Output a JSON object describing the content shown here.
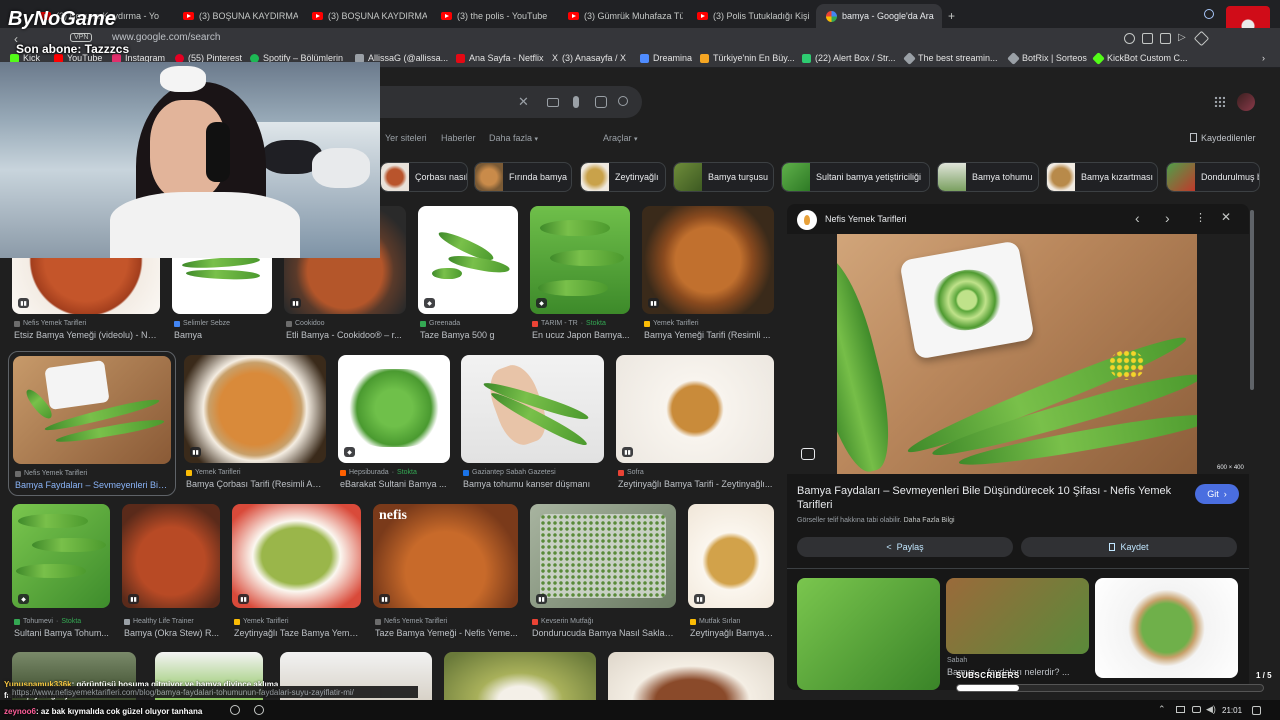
{
  "browser": {
    "tabs": [
      {
        "label": "(3) Boşuna Kaydırma - Yo",
        "active": false
      },
      {
        "label": "(3) BOŞUNA KAYDIRMA",
        "active": false
      },
      {
        "label": "(3) BOŞUNA KAYDIRMA",
        "active": false
      },
      {
        "label": "(3) the polis - YouTube",
        "active": false
      },
      {
        "label": "(3) Gümrük Muhafaza Tür",
        "active": false
      },
      {
        "label": "(3) Polis Tutukladığı Kişin",
        "active": false
      },
      {
        "label": "bamya - Google'da Ara",
        "active": true
      }
    ],
    "new_tab": "+",
    "url": "www.google.com/search",
    "vpn_label": "VPN",
    "bookmarks": [
      {
        "label": "Kick",
        "color": "#53fc18"
      },
      {
        "label": "YouTube",
        "color": "#ff0000"
      },
      {
        "label": "Instagram",
        "color": "#e1306c"
      },
      {
        "label": "(55) Pinterest",
        "color": "#e60023"
      },
      {
        "label": "Spotify – Bölümlerin",
        "color": "#1db954"
      },
      {
        "label": "AllissaG (@allissa...",
        "color": "#9aa0a6"
      },
      {
        "label": "Ana Sayfa - Netflix",
        "color": "#e50914"
      },
      {
        "label": "(3) Anasayfa / X",
        "color": "#ffffff"
      },
      {
        "label": "Dreamina",
        "color": "#4f8cff"
      },
      {
        "label": "Türkiye'nin En Büy...",
        "color": "#f5a623"
      },
      {
        "label": "(22) Alert Box / Str...",
        "color": "#2ecc71"
      },
      {
        "label": "The best streamin...",
        "color": "#9aa0a6"
      },
      {
        "label": "BotRix | Sorteos",
        "color": "#9aa0a6"
      },
      {
        "label": "KickBot Custom C...",
        "color": "#53fc18"
      }
    ]
  },
  "google": {
    "nav_links": [
      "Yer siteleri",
      "Haberler",
      "Daha fazla",
      "Araçlar"
    ],
    "saved_label": "Kaydedilenler",
    "chips": [
      {
        "label": "Çorbası nasıl",
        "color": "#b9542c"
      },
      {
        "label": "Fırında bamya",
        "color": "#c98b4a"
      },
      {
        "label": "Zeytinyağlı",
        "color": "#c9a24a"
      },
      {
        "label": "Bamya turşusu",
        "color": "#6e8c3a"
      },
      {
        "label": "Sultani bamya yetiştiriciliği",
        "color": "#4f9a3a"
      },
      {
        "label": "Bamya tohumu",
        "color": "#d8dcd0"
      },
      {
        "label": "Bamya kızartması",
        "color": "#b88a4a"
      },
      {
        "label": "Dondurulmuş b",
        "color": "#4fa04a"
      }
    ],
    "row1": [
      {
        "source": "Nefis Yemek Tarifleri",
        "title": "Etsiz Bamya Yemeği (videolu) - Ne...",
        "stock": ""
      },
      {
        "source": "Selimler Sebze",
        "title": "Bamya",
        "stock": ""
      },
      {
        "source": "Cookidoo",
        "title": "Etli Bamya - Cookidoo® – r...",
        "stock": ""
      },
      {
        "source": "Greenada",
        "title": "Taze Bamya 500 g",
        "stock": ""
      },
      {
        "source": "TARIM - TR",
        "title": "En ucuz Japon Bamya...",
        "stock": "Stokta"
      },
      {
        "source": "Yemek Tarifleri",
        "title": "Bamya Yemeği Tarifi (Resimli ...",
        "stock": ""
      }
    ],
    "row2": [
      {
        "source": "Nefis Yemek Tarifleri",
        "title": "Bamya Faydaları – Sevmeyenleri Bile...",
        "stock": ""
      },
      {
        "source": "Yemek Tarifleri",
        "title": "Bamya Çorbası Tarifi (Resimli Anl...",
        "stock": ""
      },
      {
        "source": "Hepsiburada",
        "title": "eBarakat Sultani Bamya ...",
        "stock": "Stokta"
      },
      {
        "source": "Gaziantep Sabah Gazetesi",
        "title": "Bamya tohumu kanser düşmanı",
        "stock": ""
      },
      {
        "source": "Sofra",
        "title": "Zeytinyağlı Bamya Tarifi - Zeytinyağlı...",
        "stock": ""
      }
    ],
    "row3": [
      {
        "source": "Tohumevi",
        "title": "Sultani Bamya Tohum...",
        "stock": "Stokta"
      },
      {
        "source": "Healthy Life Trainer",
        "title": "Bamya (Okra Stew) R...",
        "stock": ""
      },
      {
        "source": "Yemek Tarifleri",
        "title": "Zeytinyağlı Taze Bamya Yeme...",
        "stock": ""
      },
      {
        "source": "Nefis Yemek Tarifleri",
        "title": "Taze Bamya Yemeği - Nefis Yeme...",
        "stock": ""
      },
      {
        "source": "Kevserin Mutfağı",
        "title": "Dondurucuda Bamya Nasıl Saklan...",
        "stock": ""
      },
      {
        "source": "Mutfak Sırları",
        "title": "Zeytinyağlı Bamya ...",
        "stock": ""
      }
    ],
    "nefis_watermark": "nefis",
    "status_url": "https://www.nefisyemektarifleri.com/blog/bamya-faydalari-tohumunun-faydalari-suyu-zayiflatir-mi/"
  },
  "panel": {
    "source": "Nefis Yemek Tarifleri",
    "image_size": "600 × 400",
    "title": "Bamya Faydaları – Sevmeyenleri Bile Düşündürecek 10 Şifası - Nefis Yemek Tarifleri",
    "visit_label": "Git",
    "copyright_text": "Görseller telif hakkına tabi olabilir.",
    "more_info": "Daha Fazla Bilgi",
    "share_label": "Paylaş",
    "save_label": "Kaydet",
    "related_source": "Sabah",
    "related_title": "Bamya ... faydaları nelerdir? ...",
    "counter": "1 / 5"
  },
  "stream": {
    "logo": "ByNoGame",
    "last_sub": "Son abone: Tazzzcs",
    "subscribers_label": "SUBSCRIBERS",
    "chat": [
      {
        "user": "Yunuspamuk336k",
        "text": ": görüntüsü hoşuma gitmiyor ve bamya diyince aklıma",
        "user_color": "#f5c542"
      },
      {
        "user": "",
        "text": "farklı şeyler geliyor",
        "user_color": "#ffffff"
      },
      {
        "user": "zeynoo6",
        "text": ": az bak kıymalıda cok güzel oluyor tanhana",
        "user_color": "#ff5e9a"
      }
    ]
  },
  "taskbar": {
    "time": "21:01"
  },
  "colors": {
    "bg": "#1f1f1f",
    "accent_blue": "#8ab4f8",
    "visit_button": "#4a6ee0"
  }
}
